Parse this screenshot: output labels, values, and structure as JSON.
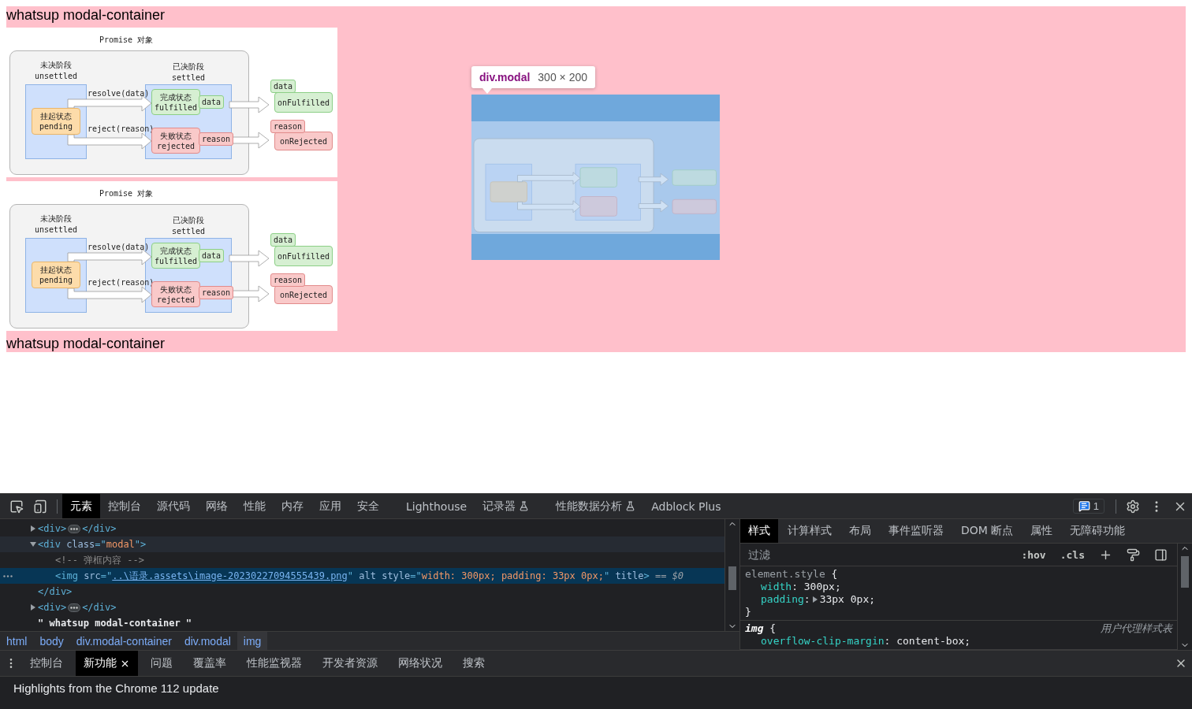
{
  "page": {
    "items": [
      {
        "kind": "text",
        "text": "whatsup modal-container"
      },
      {
        "kind": "diagram",
        "title": "Promise 对象",
        "phases": [
          {
            "title": "未决阶段",
            "subtitle": "unsettled"
          },
          {
            "title": "已决阶段",
            "subtitle": "settled"
          }
        ],
        "pending": {
          "title": "挂起状态",
          "subtitle": "pending"
        },
        "outcomes": [
          {
            "kind": "fulfilled",
            "call": "resolve(data)",
            "title": "完成状态",
            "subtitle": "fulfilled",
            "value": "data",
            "handler": "onFulfilled",
            "handler_value": "data"
          },
          {
            "kind": "rejected",
            "call": "reject(reason)",
            "title": "失败状态",
            "subtitle": "rejected",
            "value": "reason",
            "handler": "onRejected",
            "handler_value": "reason"
          }
        ]
      },
      {
        "kind": "diagram",
        "title": "Promise 对象",
        "phases": [
          {
            "title": "未决阶段",
            "subtitle": "unsettled"
          },
          {
            "title": "已决阶段",
            "subtitle": "settled"
          }
        ],
        "pending": {
          "title": "挂起状态",
          "subtitle": "pending"
        },
        "outcomes": [
          {
            "kind": "fulfilled",
            "call": "resolve(data)",
            "title": "完成状态",
            "subtitle": "fulfilled",
            "value": "data",
            "handler": "onFulfilled",
            "handler_value": "data"
          },
          {
            "kind": "rejected",
            "call": "reject(reason)",
            "title": "失败状态",
            "subtitle": "rejected",
            "value": "reason",
            "handler": "onRejected",
            "handler_value": "reason"
          }
        ]
      },
      {
        "kind": "text",
        "text": "whatsup modal-container"
      }
    ],
    "modal": {
      "tooltip_name": "div.modal",
      "tooltip_size": "300 × 200"
    }
  },
  "devtools": {
    "tabs": [
      {
        "label": "元素",
        "selected": true,
        "experimental": false
      },
      {
        "label": "控制台",
        "selected": false,
        "experimental": false
      },
      {
        "label": "源代码",
        "selected": false,
        "experimental": false
      },
      {
        "label": "网络",
        "selected": false,
        "experimental": false
      },
      {
        "label": "性能",
        "selected": false,
        "experimental": false
      },
      {
        "label": "内存",
        "selected": false,
        "experimental": false
      },
      {
        "label": "应用",
        "selected": false,
        "experimental": false
      },
      {
        "label": "安全",
        "selected": false,
        "experimental": false
      },
      {
        "label": "Lighthouse",
        "selected": false,
        "experimental": false
      },
      {
        "label": "记录器",
        "selected": false,
        "experimental": true
      },
      {
        "label": "性能数据分析",
        "selected": false,
        "experimental": true
      },
      {
        "label": "Adblock Plus",
        "selected": false,
        "experimental": false
      }
    ],
    "issues_count": "1",
    "dom_tree": [
      {
        "expanded": false,
        "selected": false,
        "hovered": false,
        "segments": [
          {
            "kind": "tag",
            "text": "<div>"
          },
          {
            "kind": "collapsed"
          },
          {
            "kind": "tag",
            "text": "</div>"
          }
        ]
      },
      {
        "expanded": true,
        "selected": false,
        "hovered": true,
        "segments": [
          {
            "kind": "tag",
            "text": "<div "
          },
          {
            "kind": "attr",
            "text": "class"
          },
          {
            "kind": "tag",
            "text": "=\""
          },
          {
            "kind": "value",
            "text": "modal"
          },
          {
            "kind": "tag",
            "text": "\">"
          }
        ],
        "children": [
          {
            "selected": false,
            "hovered": false,
            "segments": [
              {
                "kind": "comment",
                "text": "<!-- 弹框内容 -->"
              }
            ]
          },
          {
            "selected": true,
            "hovered": false,
            "segments": [
              {
                "kind": "tag",
                "text": "<img "
              },
              {
                "kind": "attr",
                "text": "src"
              },
              {
                "kind": "tag",
                "text": "=\""
              },
              {
                "kind": "link",
                "text": "..\\语录.assets\\image-20230227094555439.png"
              },
              {
                "kind": "tag",
                "text": "\" "
              },
              {
                "kind": "attr",
                "text": "alt style"
              },
              {
                "kind": "tag",
                "text": "=\""
              },
              {
                "kind": "value",
                "text": "width: 300px; padding: 33px 0px;"
              },
              {
                "kind": "tag",
                "text": "\" "
              },
              {
                "kind": "attr",
                "text": "title"
              },
              {
                "kind": "tag",
                "text": ">"
              },
              {
                "kind": "marker",
                "text": " == $0"
              }
            ]
          }
        ],
        "closing": [
          {
            "kind": "tag",
            "text": "</div>"
          }
        ]
      },
      {
        "expanded": false,
        "selected": false,
        "hovered": false,
        "segments": [
          {
            "kind": "tag",
            "text": "<div>"
          },
          {
            "kind": "collapsed"
          },
          {
            "kind": "tag",
            "text": "</div>"
          }
        ]
      },
      {
        "selected": false,
        "hovered": false,
        "segments": [
          {
            "kind": "text",
            "text": "\" whatsup modal-container \""
          }
        ]
      }
    ],
    "breadcrumbs": [
      {
        "label": "html",
        "selected": false
      },
      {
        "label": "body",
        "selected": false
      },
      {
        "label": "div.modal-container",
        "selected": false
      },
      {
        "label": "div.modal",
        "selected": false
      },
      {
        "label": "img",
        "selected": true
      }
    ],
    "styles": {
      "tabs": [
        {
          "label": "样式",
          "selected": true
        },
        {
          "label": "计算样式",
          "selected": false
        },
        {
          "label": "布局",
          "selected": false
        },
        {
          "label": "事件监听器",
          "selected": false
        },
        {
          "label": "DOM 断点",
          "selected": false
        },
        {
          "label": "属性",
          "selected": false
        },
        {
          "label": "无障碍功能",
          "selected": false
        }
      ],
      "filter_placeholder": "过滤",
      "toggles": [
        ":hov",
        ".cls"
      ],
      "rules": [
        {
          "selector": "element.style",
          "italic": false,
          "open": "{",
          "declarations": [
            [
              {
                "kind": "prop",
                "text": "width"
              },
              {
                "kind": "css",
                "text": ": 300px;"
              }
            ],
            [
              {
                "kind": "prop",
                "text": "padding"
              },
              {
                "kind": "css",
                "text": ":"
              },
              {
                "kind": "expander"
              },
              {
                "kind": "css",
                "text": "33px 0px;"
              }
            ]
          ],
          "close": "}"
        },
        {
          "selector": "img",
          "italic": true,
          "open": "{",
          "source": "用户代理样式表",
          "declarations": [
            [
              {
                "kind": "prop",
                "text": "overflow-clip-margin"
              },
              {
                "kind": "css",
                "text": ": content-box;"
              }
            ]
          ]
        }
      ]
    },
    "drawer": {
      "tabs": [
        {
          "label": "控制台",
          "selected": false,
          "closable": false
        },
        {
          "label": "新功能",
          "selected": true,
          "closable": true
        },
        {
          "label": "问题",
          "selected": false,
          "closable": false
        },
        {
          "label": "覆盖率",
          "selected": false,
          "closable": false
        },
        {
          "label": "性能监视器",
          "selected": false,
          "closable": false
        },
        {
          "label": "开发者资源",
          "selected": false,
          "closable": false
        },
        {
          "label": "网络状况",
          "selected": false,
          "closable": false
        },
        {
          "label": "搜索",
          "selected": false,
          "closable": false
        }
      ],
      "content": "Highlights from the Chrome 112 update"
    }
  }
}
